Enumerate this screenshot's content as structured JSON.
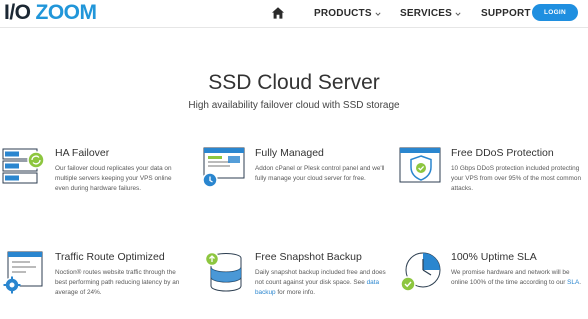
{
  "header": {
    "logo_io": "I/O",
    "logo_zoom": "ZOOM",
    "nav": {
      "products": "PRODUCTS",
      "services": "SERVICES",
      "support": "SUPPORT"
    },
    "login_label": "LOGIN"
  },
  "hero": {
    "title": "SSD Cloud Server",
    "subtitle": "High availability failover cloud with SSD storage"
  },
  "features": [
    {
      "title": "HA Failover",
      "desc": "Our failover cloud replicates your data on multiple servers keeping your VPS online even during hardware failures.",
      "icon": "server-failover-icon"
    },
    {
      "title": "Fully Managed",
      "desc": "Addon cPanel or Plesk control panel and we'll fully manage your cloud server for free.",
      "icon": "managed-window-icon"
    },
    {
      "title": "Free DDoS Protection",
      "desc": "10 Gbps DDoS protection included protecting your VPS from over 95% of the most common attacks.",
      "icon": "shield-icon"
    },
    {
      "title": "Traffic Route Optimized",
      "desc": "Noction® routes website traffic through the best performing path reducing latency by an average of 24%.",
      "icon": "route-gear-icon"
    },
    {
      "title": "Free Snapshot Backup",
      "desc_before": "Daily snapshot backup included free and does not count against your disk space. See ",
      "link": "data backup",
      "desc_after": " for more info.",
      "icon": "database-backup-icon"
    },
    {
      "title": "100% Uptime SLA",
      "desc_before": "We promise hardware and network will be online 100% of the time according to our ",
      "link": "SLA",
      "desc_after": ".",
      "icon": "uptime-clock-icon"
    }
  ],
  "colors": {
    "brand_blue": "#2196d9",
    "login_blue": "#1f8fe0",
    "icon_green": "#8dc63f",
    "icon_blue": "#2a86cf",
    "icon_navy": "#2c3e50"
  }
}
